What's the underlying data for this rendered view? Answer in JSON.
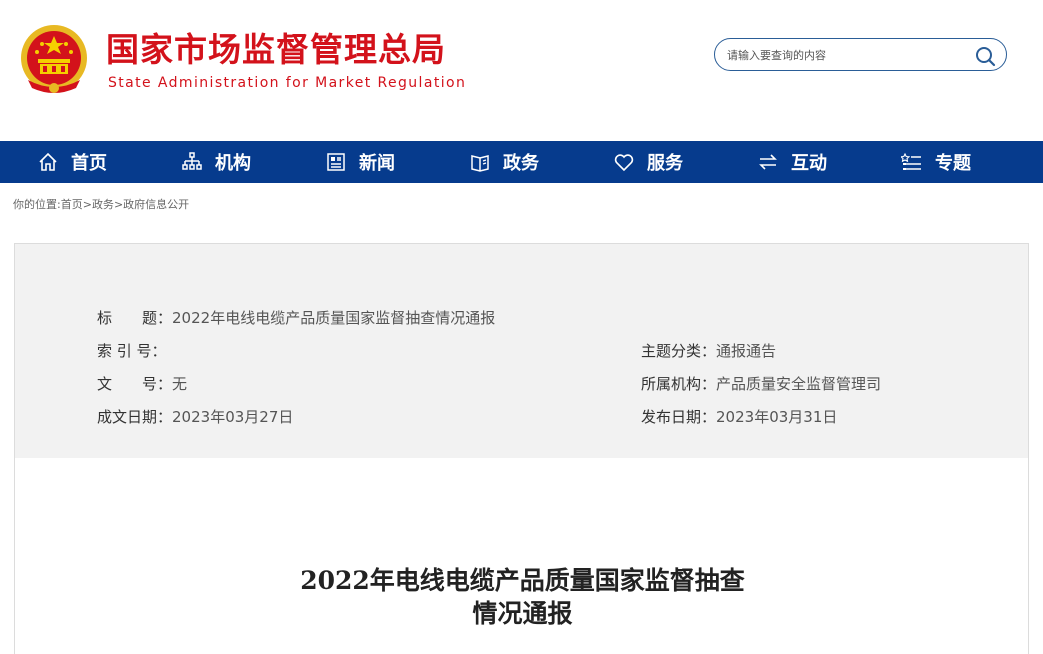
{
  "header": {
    "title_cn": "国家市场监督管理总局",
    "title_en": "State Administration for Market Regulation",
    "emblem_icon": "national-emblem-icon",
    "search_placeholder": "请输入要查询的内容",
    "search_icon": "search-icon"
  },
  "colors": {
    "brand_red": "#d3121b",
    "nav_blue": "#063b8d",
    "search_border": "#2a5d97"
  },
  "nav": {
    "items": [
      {
        "label": "首页",
        "icon": "home-icon"
      },
      {
        "label": "机构",
        "icon": "org-chart-icon"
      },
      {
        "label": "新闻",
        "icon": "news-icon"
      },
      {
        "label": "政务",
        "icon": "book-icon"
      },
      {
        "label": "服务",
        "icon": "heart-icon"
      },
      {
        "label": "互动",
        "icon": "exchange-icon"
      },
      {
        "label": "专题",
        "icon": "list-icon"
      }
    ]
  },
  "breadcrumb": {
    "prefix": "你的位置:",
    "items": [
      "首页",
      "政务",
      "政府信息公开"
    ],
    "sep": ">"
  },
  "info": {
    "title_label": "标　　题：",
    "title_value": "2022年电线电缆产品质量国家监督抽查情况通报",
    "index_label": "索 引 号：",
    "index_value": "",
    "topic_label": "主题分类：",
    "topic_value": "通报通告",
    "doc_label": "文　　号：",
    "doc_value": "无",
    "org_label": "所属机构：",
    "org_value": "产品质量安全监督管理司",
    "written_label": "成文日期：",
    "written_value": "2023年03月27日",
    "publish_label": "发布日期：",
    "publish_value": "2023年03月31日"
  },
  "article": {
    "title_line1": "2022年电线电缆产品质量国家监督抽查",
    "title_line2": "情况通报"
  }
}
